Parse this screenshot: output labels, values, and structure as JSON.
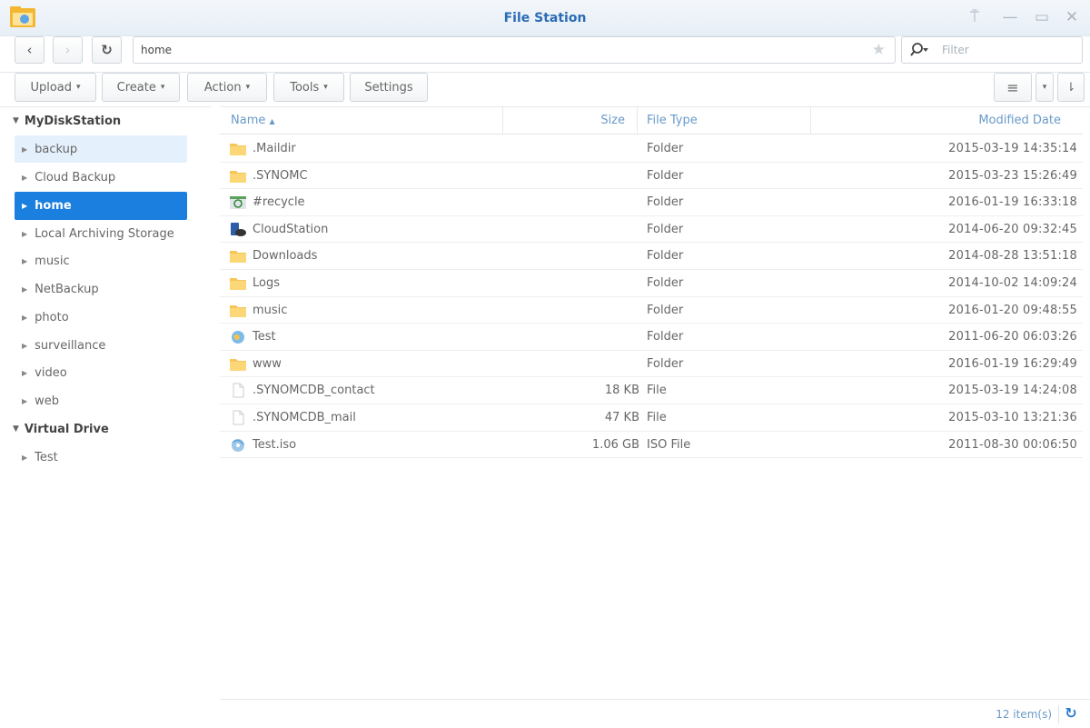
{
  "window": {
    "title": "File Station",
    "controls": [
      "pin-icon",
      "minimize-icon",
      "maximize-icon",
      "close-icon"
    ]
  },
  "nav": {
    "back_icon": "chevron-left-icon",
    "forward_icon": "chevron-right-icon",
    "refresh_icon": "refresh-icon",
    "path": "home",
    "filter_placeholder": "Filter"
  },
  "toolbar": {
    "upload": "Upload",
    "create": "Create",
    "action": "Action",
    "tools": "Tools",
    "settings": "Settings"
  },
  "sidebar": {
    "root1": "MyDiskStation",
    "root1_items": [
      "backup",
      "Cloud Backup",
      "home",
      "Local Archiving Storage",
      "music",
      "NetBackup",
      "photo",
      "surveillance",
      "video",
      "web"
    ],
    "root2": "Virtual Drive",
    "root2_items": [
      "Test"
    ],
    "selected": "home",
    "hovered": "backup"
  },
  "list": {
    "columns": {
      "name": "Name",
      "size": "Size",
      "type": "File Type",
      "date": "Modified Date"
    },
    "rows": [
      {
        "name": ".Maildir",
        "size": "",
        "type": "Folder",
        "date": "2015-03-19 14:35:14",
        "icon": "folder-icon"
      },
      {
        "name": ".SYNOMC",
        "size": "",
        "type": "Folder",
        "date": "2015-03-23 15:26:49",
        "icon": "folder-icon"
      },
      {
        "name": "#recycle",
        "size": "",
        "type": "Folder",
        "date": "2016-01-19 16:33:18",
        "icon": "recycle-bin-icon"
      },
      {
        "name": "CloudStation",
        "size": "",
        "type": "Folder",
        "date": "2014-06-20 09:32:45",
        "icon": "cloud-station-icon"
      },
      {
        "name": "Downloads",
        "size": "",
        "type": "Folder",
        "date": "2014-08-28 13:51:18",
        "icon": "folder-icon"
      },
      {
        "name": "Logs",
        "size": "",
        "type": "Folder",
        "date": "2014-10-02 14:09:24",
        "icon": "folder-icon"
      },
      {
        "name": "music",
        "size": "",
        "type": "Folder",
        "date": "2016-01-20 09:48:55",
        "icon": "folder-icon"
      },
      {
        "name": "Test",
        "size": "",
        "type": "Folder",
        "date": "2011-06-20 06:03:26",
        "icon": "globe-icon"
      },
      {
        "name": "www",
        "size": "",
        "type": "Folder",
        "date": "2016-01-19 16:29:49",
        "icon": "folder-icon"
      },
      {
        "name": ".SYNOMCDB_contact",
        "size": "18 KB",
        "type": "File",
        "date": "2015-03-19 14:24:08",
        "icon": "file-icon"
      },
      {
        "name": ".SYNOMCDB_mail",
        "size": "47 KB",
        "type": "File",
        "date": "2015-03-10 13:21:36",
        "icon": "file-icon"
      },
      {
        "name": "Test.iso",
        "size": "1.06 GB",
        "type": "ISO File",
        "date": "2011-08-30 00:06:50",
        "icon": "disc-image-icon"
      }
    ]
  },
  "status": {
    "count": "12 item(s)"
  },
  "colors": {
    "accent": "#1a7fde",
    "header_text": "#6a9ac9",
    "title_text": "#2a6bb5",
    "folder": "#f7c65a"
  }
}
